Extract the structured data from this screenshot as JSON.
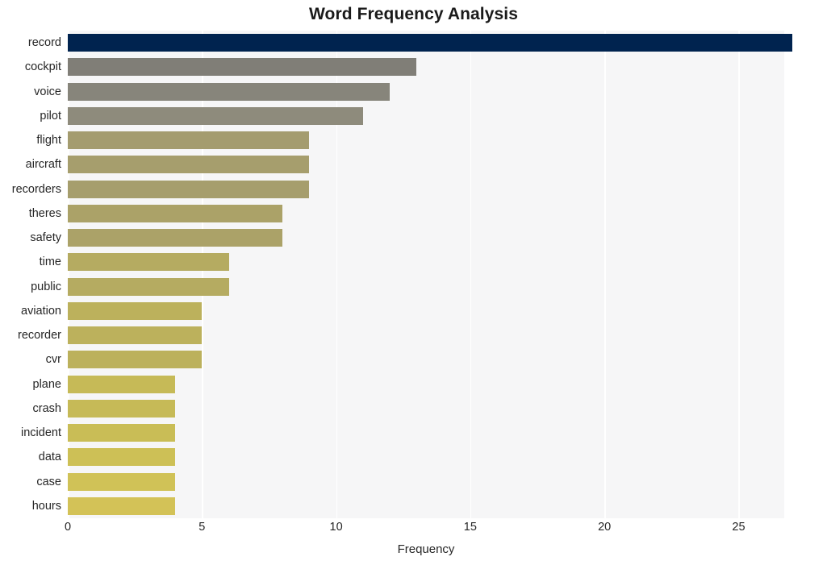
{
  "chart_data": {
    "type": "bar",
    "orientation": "horizontal",
    "title": "Word Frequency Analysis",
    "xlabel": "Frequency",
    "ylabel": "",
    "categories": [
      "record",
      "cockpit",
      "voice",
      "pilot",
      "flight",
      "aircraft",
      "recorders",
      "theres",
      "safety",
      "time",
      "public",
      "aviation",
      "recorder",
      "cvr",
      "plane",
      "crash",
      "incident",
      "data",
      "case",
      "hours"
    ],
    "values": [
      27,
      13,
      12,
      11,
      9,
      9,
      9,
      8,
      8,
      6,
      6,
      5,
      5,
      5,
      4,
      4,
      4,
      4,
      4,
      4
    ],
    "bar_colors": [
      "#00234f",
      "#807e77",
      "#87857b",
      "#8e8b7c",
      "#a49c6f",
      "#a69e6d",
      "#a69e6d",
      "#aba268",
      "#aba268",
      "#b5ab61",
      "#b5ab61",
      "#bcb15c",
      "#bcb15c",
      "#bcb15c",
      "#c6ba57",
      "#c6ba57",
      "#c9bd56",
      "#cdc056",
      "#d0c257",
      "#d3c257"
    ],
    "xlim": [
      0,
      26.7
    ],
    "x_ticks": [
      "0",
      "5",
      "10",
      "15",
      "20",
      "25"
    ],
    "x_tick_values": [
      0,
      5,
      10,
      15,
      20,
      25
    ],
    "grid": true,
    "grid_axis": "x",
    "plot_background": "#f6f6f7",
    "figure_background": "#ffffff",
    "legend": "none"
  }
}
